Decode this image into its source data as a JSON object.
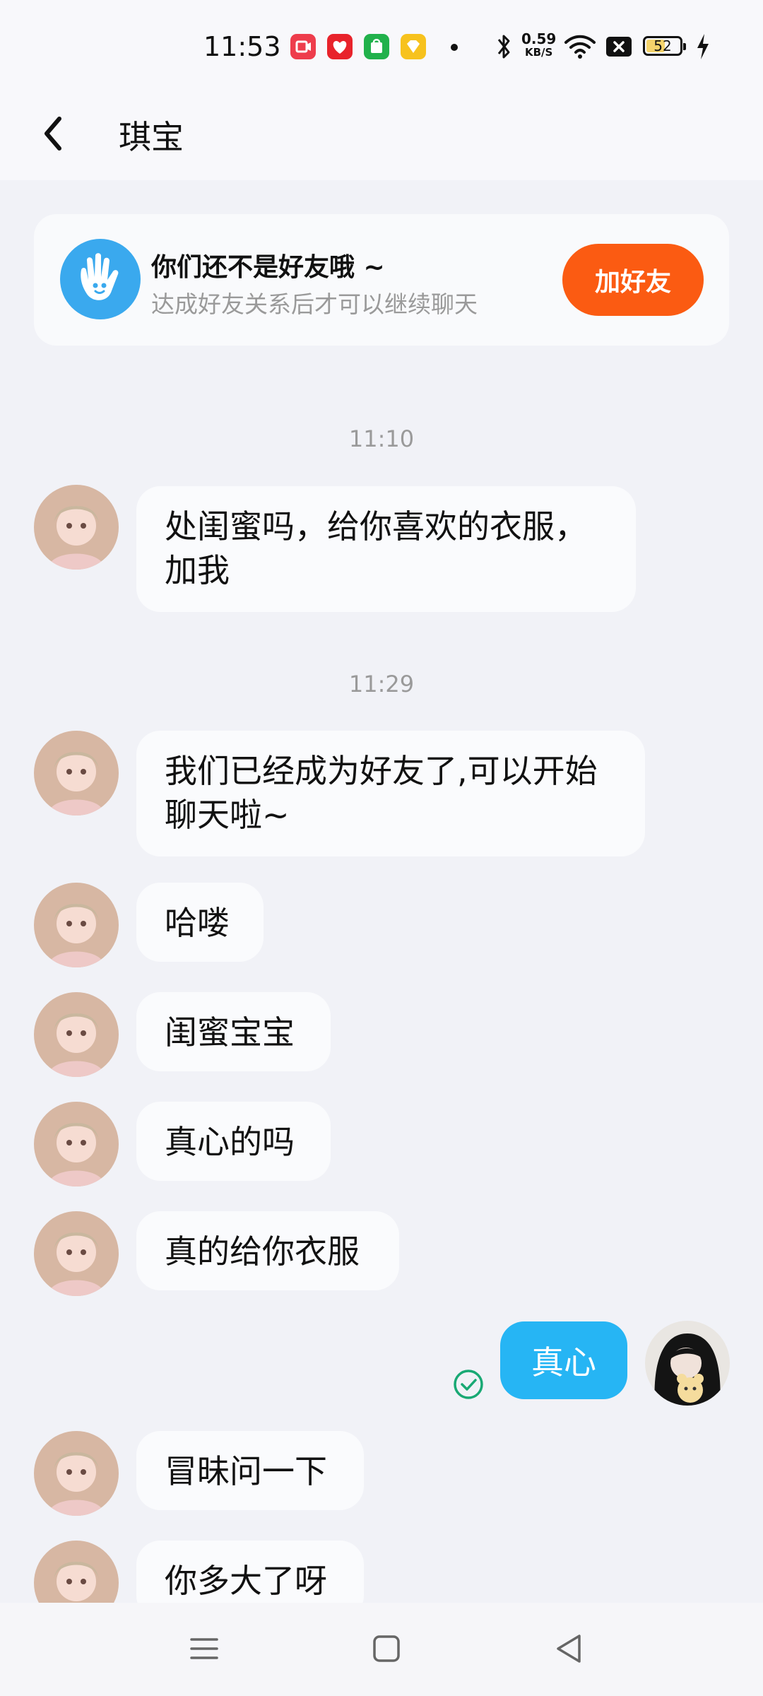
{
  "status_bar": {
    "time": "11:53",
    "network_speed": "0.59",
    "network_unit": "KB/S",
    "battery": "52",
    "app_icons": [
      {
        "name": "red-video-app-icon",
        "color": "#ee3d4c"
      },
      {
        "name": "red-heart-app-icon",
        "color": "#e8232b"
      },
      {
        "name": "green-shopping-app-icon",
        "color": "#21b14b"
      },
      {
        "name": "yellow-diamond-app-icon",
        "color": "#f7c21d"
      }
    ]
  },
  "header": {
    "title": "琪宝"
  },
  "banner": {
    "title": "你们还不是好友哦 ~",
    "subtitle": "达成好友关系后才可以继续聊天",
    "button": "加好友"
  },
  "messages": [
    {
      "type": "time",
      "text": "11:10"
    },
    {
      "type": "in",
      "lines": [
        "处闺蜜吗，给你喜欢的衣服，",
        "加我"
      ]
    },
    {
      "type": "time",
      "text": "11:29"
    },
    {
      "type": "in",
      "lines": [
        "我们已经成为好友了,可以开始",
        "聊天啦~"
      ]
    },
    {
      "type": "in",
      "lines": [
        "哈喽"
      ]
    },
    {
      "type": "in",
      "lines": [
        "闺蜜宝宝"
      ]
    },
    {
      "type": "in",
      "lines": [
        "真心的吗"
      ]
    },
    {
      "type": "in",
      "lines": [
        "真的给你衣服"
      ]
    },
    {
      "type": "out",
      "lines": [
        "真心"
      ],
      "status": "read"
    },
    {
      "type": "in",
      "lines": [
        "冒昧问一下"
      ]
    },
    {
      "type": "in",
      "lines": [
        "你多大了呀"
      ]
    }
  ],
  "colors": {
    "accent_orange": "#fb5b12",
    "outgoing_bubble": "#26b5f4",
    "read_check": "#19a974"
  }
}
